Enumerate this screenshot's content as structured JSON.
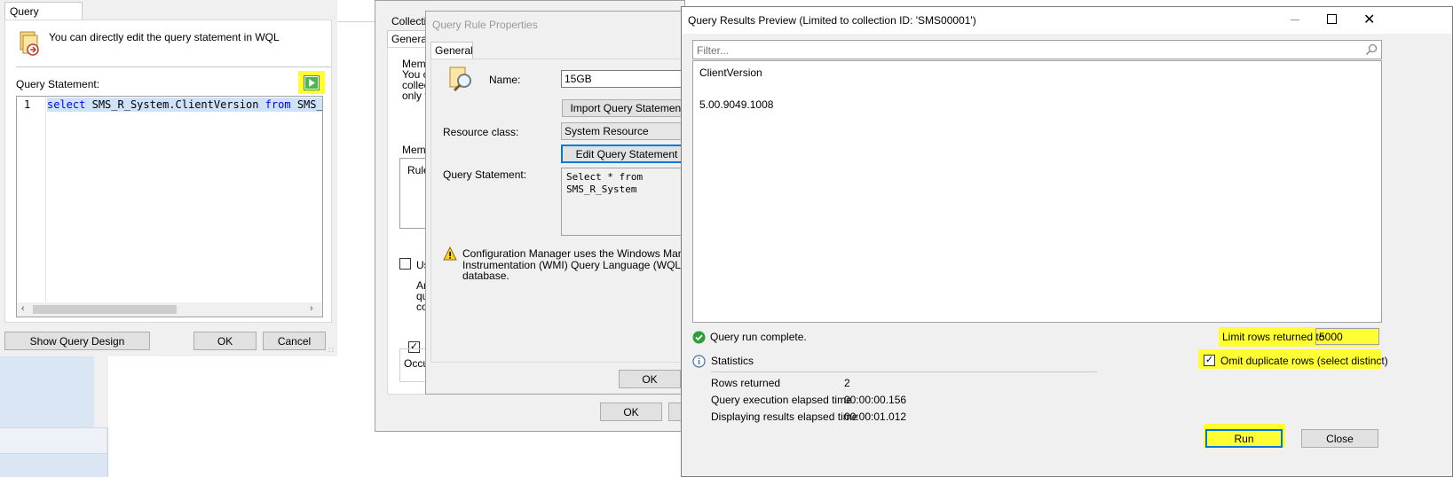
{
  "qlang": {
    "tab": "Query Language",
    "info": "You can directly edit the query statement in WQL",
    "statement_label": "Query Statement:",
    "line_no": "1",
    "kw_select": "select",
    "code_mid": "SMS_R_System.ClientVersion",
    "kw_from": "from",
    "code_end": "SMS_R_",
    "show_design": "Show Query Design",
    "ok": "OK",
    "cancel": "Cancel"
  },
  "collection": {
    "tab_collections": "Collectio",
    "tab_general": "General",
    "memb1": "Memb",
    "desc1": "You c",
    "desc2": "collec",
    "desc3": "only th",
    "memb2": "Memb",
    "rule": "Rule",
    "use": "Us",
    "an1": "An",
    "an2": "qu",
    "an3": "co",
    "occu": "Occu",
    "ok": "OK"
  },
  "rule_props": {
    "title": "Query Rule Properties",
    "tab": "General",
    "name_label": "Name:",
    "name_value": "15GB",
    "import_btn": "Import Query Statement",
    "resource_label": "Resource class:",
    "resource_value": "System Resource",
    "edit_btn": "Edit Query Statement",
    "query_label": "Query Statement:",
    "query_line1": "Select * from",
    "query_line2": "SMS_R_System",
    "warning_line1": "Configuration Manager uses the Windows Management",
    "warning_line2": "Instrumentation (WMI) Query Language (WQL) to query",
    "warning_line3": "database.",
    "ok": "OK"
  },
  "preview": {
    "title": "Query Results Preview (Limited to collection ID: 'SMS00001')",
    "filter_placeholder": "Filter...",
    "column_header": "ClientVersion",
    "row_value": "5.00.9049.1008",
    "status": "Query run complete.",
    "limit_label": "Limit rows returned to",
    "limit_value": "5000",
    "statistics": "Statistics",
    "omit_label": "Omit duplicate rows (select distinct)",
    "stats": [
      {
        "label": "Rows returned",
        "value": "2"
      },
      {
        "label": "Query execution elapsed time",
        "value": "00:00:00.156"
      },
      {
        "label": "Displaying results elapsed time",
        "value": "00:00:01.012"
      }
    ],
    "run": "Run",
    "close": "Close",
    "highlight_color": "#ffff33"
  }
}
